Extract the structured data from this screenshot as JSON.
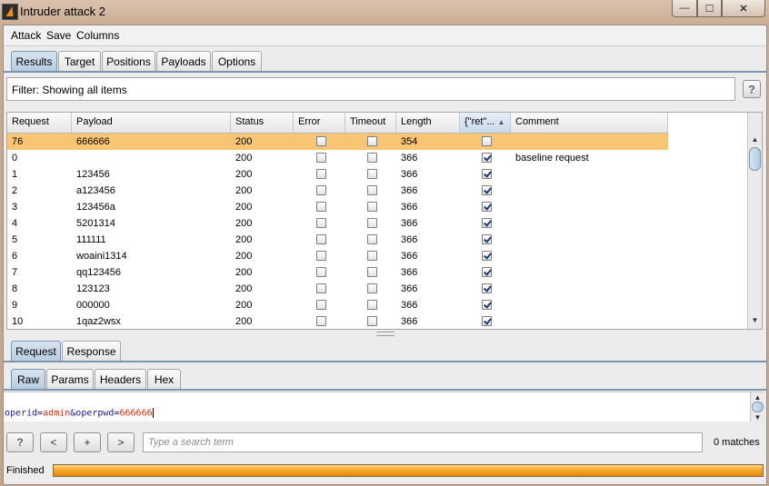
{
  "window": {
    "title": "Intruder attack 2",
    "min_glyph": "—",
    "max_glyph": "☐",
    "close_glyph": "✕"
  },
  "menu": [
    "Attack",
    "Save",
    "Columns"
  ],
  "top_tabs": [
    "Results",
    "Target",
    "Positions",
    "Payloads",
    "Options"
  ],
  "top_tab_active": "Results",
  "filter": {
    "text": "Filter:  Showing all items",
    "help": "?"
  },
  "table": {
    "columns": [
      "Request",
      "Payload",
      "Status",
      "Error",
      "Timeout",
      "Length",
      "{\"ret\"...",
      "Comment"
    ],
    "sorted_column": "{\"ret\"...",
    "sort_glyph": "▲",
    "rows": [
      {
        "request": "76",
        "payload": "666666",
        "status": "200",
        "error": false,
        "timeout": false,
        "length": "354",
        "ret": false,
        "comment": "",
        "selected": true
      },
      {
        "request": "0",
        "payload": "",
        "status": "200",
        "error": false,
        "timeout": false,
        "length": "366",
        "ret": true,
        "comment": "baseline request"
      },
      {
        "request": "1",
        "payload": "123456",
        "status": "200",
        "error": false,
        "timeout": false,
        "length": "366",
        "ret": true,
        "comment": ""
      },
      {
        "request": "2",
        "payload": "a123456",
        "status": "200",
        "error": false,
        "timeout": false,
        "length": "366",
        "ret": true,
        "comment": ""
      },
      {
        "request": "3",
        "payload": "123456a",
        "status": "200",
        "error": false,
        "timeout": false,
        "length": "366",
        "ret": true,
        "comment": ""
      },
      {
        "request": "4",
        "payload": "5201314",
        "status": "200",
        "error": false,
        "timeout": false,
        "length": "366",
        "ret": true,
        "comment": ""
      },
      {
        "request": "5",
        "payload": "111111",
        "status": "200",
        "error": false,
        "timeout": false,
        "length": "366",
        "ret": true,
        "comment": ""
      },
      {
        "request": "6",
        "payload": "woaini1314",
        "status": "200",
        "error": false,
        "timeout": false,
        "length": "366",
        "ret": true,
        "comment": ""
      },
      {
        "request": "7",
        "payload": "qq123456",
        "status": "200",
        "error": false,
        "timeout": false,
        "length": "366",
        "ret": true,
        "comment": ""
      },
      {
        "request": "8",
        "payload": "123123",
        "status": "200",
        "error": false,
        "timeout": false,
        "length": "366",
        "ret": true,
        "comment": ""
      },
      {
        "request": "9",
        "payload": "000000",
        "status": "200",
        "error": false,
        "timeout": false,
        "length": "366",
        "ret": true,
        "comment": ""
      },
      {
        "request": "10",
        "payload": "1qaz2wsx",
        "status": "200",
        "error": false,
        "timeout": false,
        "length": "366",
        "ret": true,
        "comment": ""
      }
    ]
  },
  "reqres_tabs": [
    "Request",
    "Response"
  ],
  "reqres_active": "Request",
  "view_tabs": [
    "Raw",
    "Params",
    "Headers",
    "Hex"
  ],
  "view_active": "Raw",
  "editor": {
    "k1": "operid",
    "eq1": "=",
    "v1": "admin",
    "amp": "&",
    "k2": "operpwd",
    "eq2": "=",
    "v2": "666666"
  },
  "search": {
    "help": "?",
    "prev": "<",
    "add": "+",
    "next": ">",
    "placeholder": "Type a search term",
    "matches": "0 matches"
  },
  "status": {
    "text": "Finished",
    "progress": 1.0
  },
  "colors": {
    "selected_row": "#f7c574",
    "progress": "#f2a020",
    "accent": "#7c96b0"
  }
}
